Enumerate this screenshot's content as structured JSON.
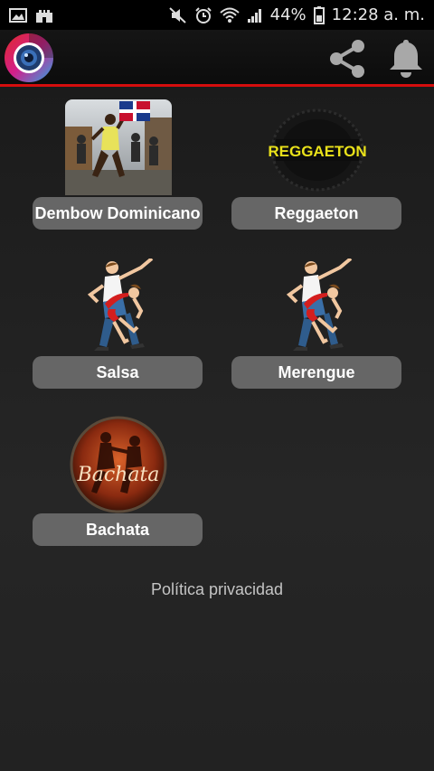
{
  "status_bar": {
    "battery": "44%",
    "time": "12:28 a. m."
  },
  "app_bar": {
    "logo_icon": "camera-lens-logo-icon",
    "actions": [
      "share-icon",
      "bell-icon"
    ],
    "accent_color": "#d40d0d"
  },
  "genres": [
    {
      "label": "Dembow Dominicano",
      "icon": "dembow-photo-with-dominican-flag"
    },
    {
      "label": "Reggaeton",
      "icon": "reggaeton-badge"
    },
    {
      "label": "Salsa",
      "icon": "dancing-couple"
    },
    {
      "label": "Merengue",
      "icon": "dancing-couple"
    },
    {
      "label": "Bachata",
      "icon": "bachata-round-badge"
    }
  ],
  "reggaeton_badge_text": "REGGAETON",
  "bachata_badge_text": "Bachata",
  "privacy_link": "Política privacidad"
}
